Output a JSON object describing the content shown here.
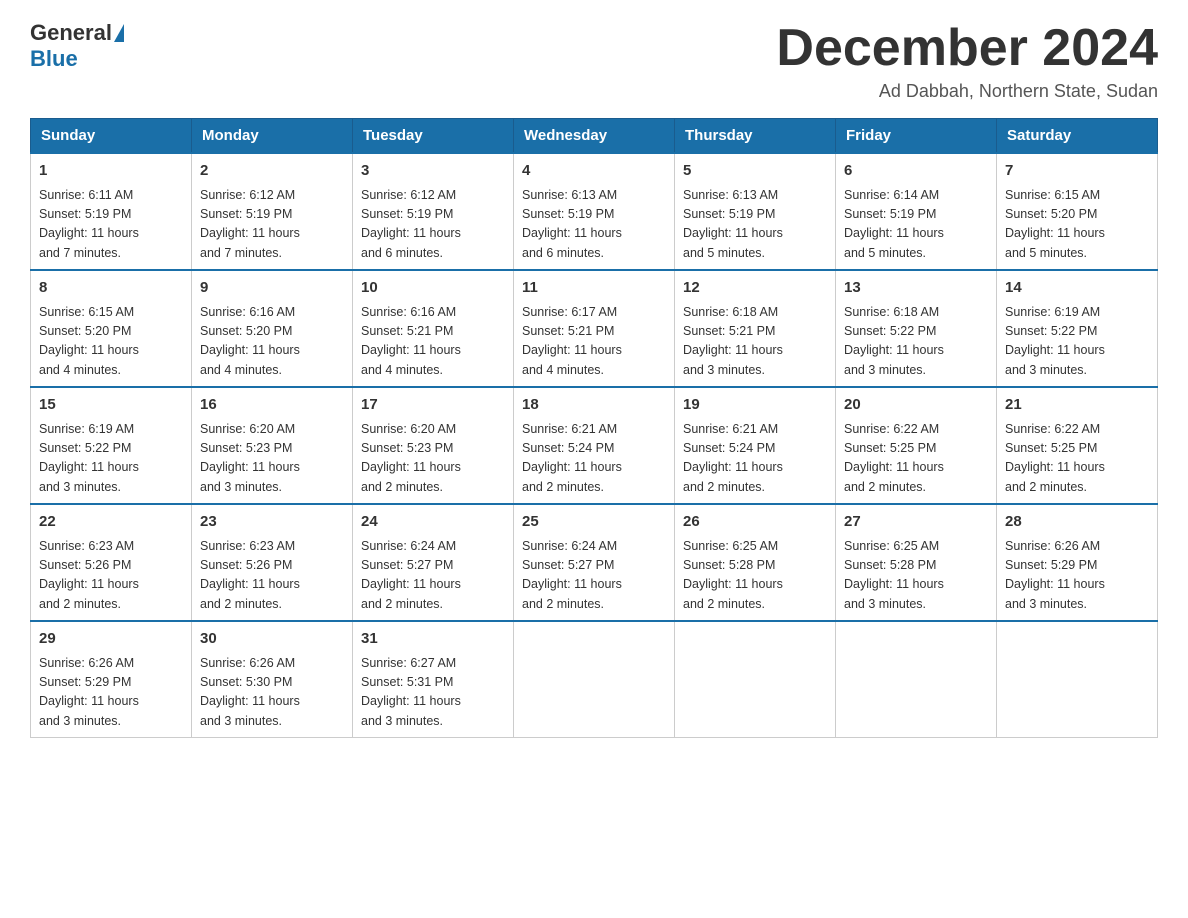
{
  "logo": {
    "general": "General",
    "blue": "Blue"
  },
  "header": {
    "month": "December 2024",
    "location": "Ad Dabbah, Northern State, Sudan"
  },
  "days_of_week": [
    "Sunday",
    "Monday",
    "Tuesday",
    "Wednesday",
    "Thursday",
    "Friday",
    "Saturday"
  ],
  "weeks": [
    [
      {
        "day": "1",
        "sunrise": "6:11 AM",
        "sunset": "5:19 PM",
        "daylight": "11 hours and 7 minutes."
      },
      {
        "day": "2",
        "sunrise": "6:12 AM",
        "sunset": "5:19 PM",
        "daylight": "11 hours and 7 minutes."
      },
      {
        "day": "3",
        "sunrise": "6:12 AM",
        "sunset": "5:19 PM",
        "daylight": "11 hours and 6 minutes."
      },
      {
        "day": "4",
        "sunrise": "6:13 AM",
        "sunset": "5:19 PM",
        "daylight": "11 hours and 6 minutes."
      },
      {
        "day": "5",
        "sunrise": "6:13 AM",
        "sunset": "5:19 PM",
        "daylight": "11 hours and 5 minutes."
      },
      {
        "day": "6",
        "sunrise": "6:14 AM",
        "sunset": "5:19 PM",
        "daylight": "11 hours and 5 minutes."
      },
      {
        "day": "7",
        "sunrise": "6:15 AM",
        "sunset": "5:20 PM",
        "daylight": "11 hours and 5 minutes."
      }
    ],
    [
      {
        "day": "8",
        "sunrise": "6:15 AM",
        "sunset": "5:20 PM",
        "daylight": "11 hours and 4 minutes."
      },
      {
        "day": "9",
        "sunrise": "6:16 AM",
        "sunset": "5:20 PM",
        "daylight": "11 hours and 4 minutes."
      },
      {
        "day": "10",
        "sunrise": "6:16 AM",
        "sunset": "5:21 PM",
        "daylight": "11 hours and 4 minutes."
      },
      {
        "day": "11",
        "sunrise": "6:17 AM",
        "sunset": "5:21 PM",
        "daylight": "11 hours and 4 minutes."
      },
      {
        "day": "12",
        "sunrise": "6:18 AM",
        "sunset": "5:21 PM",
        "daylight": "11 hours and 3 minutes."
      },
      {
        "day": "13",
        "sunrise": "6:18 AM",
        "sunset": "5:22 PM",
        "daylight": "11 hours and 3 minutes."
      },
      {
        "day": "14",
        "sunrise": "6:19 AM",
        "sunset": "5:22 PM",
        "daylight": "11 hours and 3 minutes."
      }
    ],
    [
      {
        "day": "15",
        "sunrise": "6:19 AM",
        "sunset": "5:22 PM",
        "daylight": "11 hours and 3 minutes."
      },
      {
        "day": "16",
        "sunrise": "6:20 AM",
        "sunset": "5:23 PM",
        "daylight": "11 hours and 3 minutes."
      },
      {
        "day": "17",
        "sunrise": "6:20 AM",
        "sunset": "5:23 PM",
        "daylight": "11 hours and 2 minutes."
      },
      {
        "day": "18",
        "sunrise": "6:21 AM",
        "sunset": "5:24 PM",
        "daylight": "11 hours and 2 minutes."
      },
      {
        "day": "19",
        "sunrise": "6:21 AM",
        "sunset": "5:24 PM",
        "daylight": "11 hours and 2 minutes."
      },
      {
        "day": "20",
        "sunrise": "6:22 AM",
        "sunset": "5:25 PM",
        "daylight": "11 hours and 2 minutes."
      },
      {
        "day": "21",
        "sunrise": "6:22 AM",
        "sunset": "5:25 PM",
        "daylight": "11 hours and 2 minutes."
      }
    ],
    [
      {
        "day": "22",
        "sunrise": "6:23 AM",
        "sunset": "5:26 PM",
        "daylight": "11 hours and 2 minutes."
      },
      {
        "day": "23",
        "sunrise": "6:23 AM",
        "sunset": "5:26 PM",
        "daylight": "11 hours and 2 minutes."
      },
      {
        "day": "24",
        "sunrise": "6:24 AM",
        "sunset": "5:27 PM",
        "daylight": "11 hours and 2 minutes."
      },
      {
        "day": "25",
        "sunrise": "6:24 AM",
        "sunset": "5:27 PM",
        "daylight": "11 hours and 2 minutes."
      },
      {
        "day": "26",
        "sunrise": "6:25 AM",
        "sunset": "5:28 PM",
        "daylight": "11 hours and 2 minutes."
      },
      {
        "day": "27",
        "sunrise": "6:25 AM",
        "sunset": "5:28 PM",
        "daylight": "11 hours and 3 minutes."
      },
      {
        "day": "28",
        "sunrise": "6:26 AM",
        "sunset": "5:29 PM",
        "daylight": "11 hours and 3 minutes."
      }
    ],
    [
      {
        "day": "29",
        "sunrise": "6:26 AM",
        "sunset": "5:29 PM",
        "daylight": "11 hours and 3 minutes."
      },
      {
        "day": "30",
        "sunrise": "6:26 AM",
        "sunset": "5:30 PM",
        "daylight": "11 hours and 3 minutes."
      },
      {
        "day": "31",
        "sunrise": "6:27 AM",
        "sunset": "5:31 PM",
        "daylight": "11 hours and 3 minutes."
      },
      null,
      null,
      null,
      null
    ]
  ],
  "labels": {
    "sunrise": "Sunrise:",
    "sunset": "Sunset:",
    "daylight": "Daylight:"
  }
}
